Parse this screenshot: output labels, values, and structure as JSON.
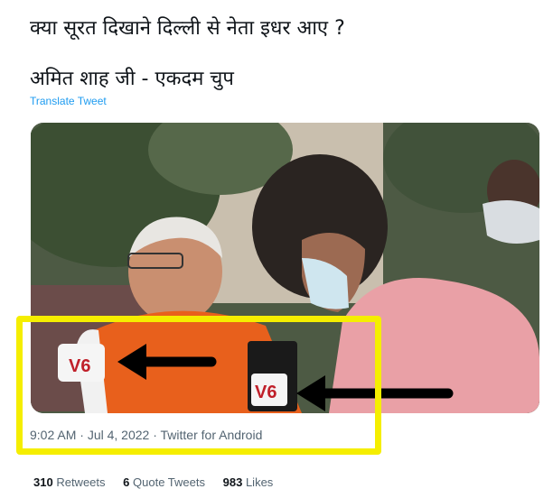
{
  "tweet": {
    "line1": "क्या सूरत दिखाने दिल्ली से नेता इधर आए ?",
    "line2": "अमित शाह जी - एकदम चुप",
    "translate_label": "Translate Tweet"
  },
  "media": {
    "logo_text": "V6",
    "colors": {
      "highlight": "#f5ee00",
      "arrow": "#000000",
      "saffron": "#e8601c",
      "pink_shirt": "#e9a0a6"
    }
  },
  "meta": {
    "time": "9:02 AM",
    "date": "Jul 4, 2022",
    "source": "Twitter for Android",
    "sep": "·"
  },
  "stats": {
    "retweets_count": "310",
    "retweets_label": "Retweets",
    "quotes_count": "6",
    "quotes_label": "Quote Tweets",
    "likes_count": "983",
    "likes_label": "Likes"
  }
}
